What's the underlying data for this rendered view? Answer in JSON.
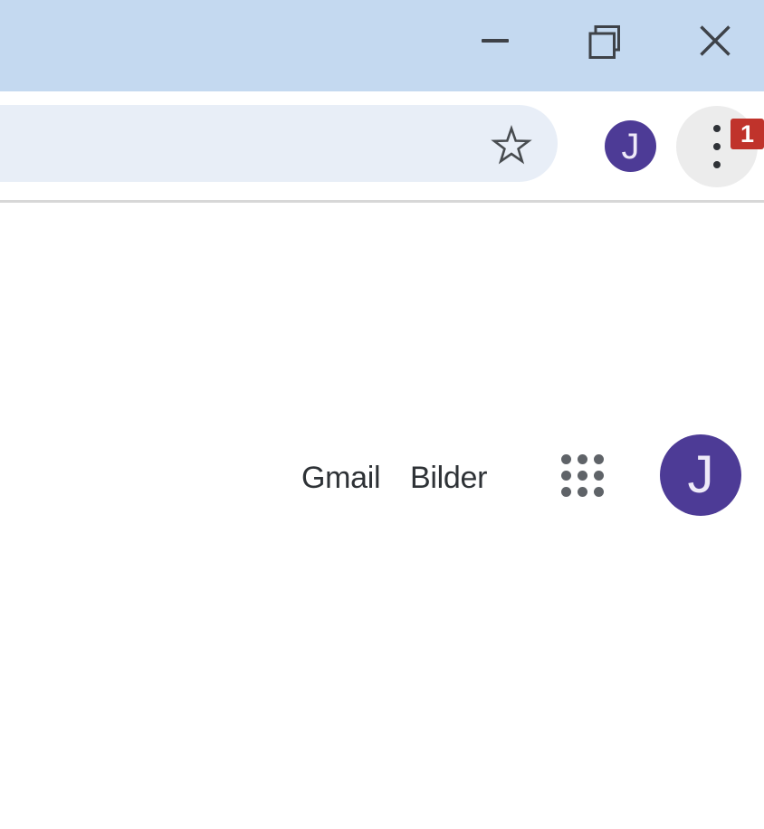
{
  "titlebar": {
    "minimize_icon": "minimize-dash",
    "restore_icon": "restore-overlapping-squares",
    "close_icon": "close-x"
  },
  "toolbar": {
    "omnibox": {
      "value": "",
      "bookmark_icon": "star-outline"
    },
    "profile_initial": "J",
    "menu_icon": "three-dot-vertical",
    "annotation_badge": "1"
  },
  "page": {
    "gmail_label": "Gmail",
    "images_label": "Bilder",
    "apps_icon": "apps-grid",
    "profile_initial": "J"
  },
  "colors": {
    "titlebar_bg": "#c4d9f0",
    "omnibox_bg": "#e8eef7",
    "avatar_purple": "#4d3b96",
    "badge_red": "#c0332b",
    "icon_gray": "#5f6368",
    "text_dark": "#2e3236"
  }
}
